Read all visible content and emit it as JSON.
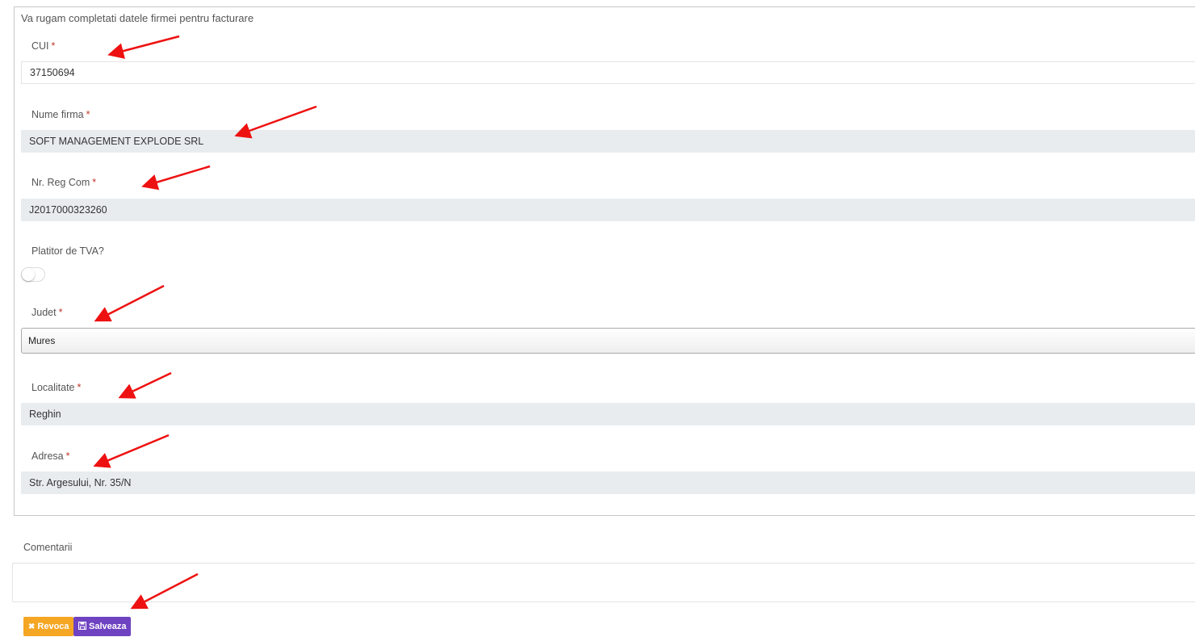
{
  "form": {
    "intro": "Va rugam completati datele firmei pentru facturare",
    "required_mark": "*",
    "cui": {
      "label": "CUI",
      "value": "37150694"
    },
    "nume_firma": {
      "label": "Nume firma",
      "value": "SOFT MANAGEMENT EXPLODE SRL"
    },
    "nr_reg_com": {
      "label": "Nr. Reg Com",
      "value": "J2017000323260"
    },
    "platitor_tva": {
      "label": "Platitor de TVA?",
      "checked": false
    },
    "judet": {
      "label": "Judet",
      "selected": "Mures"
    },
    "localitate": {
      "label": "Localitate",
      "value": "Reghin"
    },
    "adresa": {
      "label": "Adresa",
      "value": "Str. Argesului, Nr. 35/N"
    }
  },
  "comentarii": {
    "label": "Comentarii",
    "value": ""
  },
  "actions": {
    "revoca_label": "Revoca",
    "revoca_icon": "close-icon",
    "salveaza_label": "Salveaza",
    "salveaza_icon": "save-icon"
  },
  "colors": {
    "annotation_arrow": "#ee1111",
    "revoca_button": "#f5a623",
    "salveaza_button": "#6f42c1",
    "required": "#c0392b",
    "readonly_field": "#e9ecef"
  }
}
